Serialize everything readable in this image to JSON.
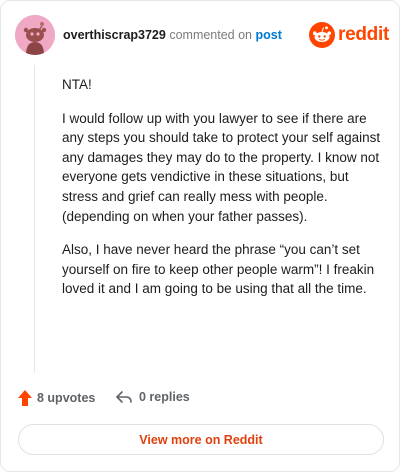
{
  "header": {
    "username": "overthiscrap3729",
    "commented_on": "commented on",
    "post_link": "post",
    "logo_text": "reddit"
  },
  "comment": {
    "paragraphs": [
      "NTA!",
      "I would follow up with you lawyer to see if there are any steps you should take to protect your self against any damages they may do to the property. I know not everyone gets vendictive in these situations, but stress and grief can really mess with people.(depending on when your father passes).",
      "Also, I have never heard the phrase “you can’t set yourself on fire to keep other people warm”! I freakin loved it and I am going to be using that all the time."
    ]
  },
  "footer": {
    "upvotes": "8 upvotes",
    "replies": "0 replies"
  },
  "view_more_label": "View more on Reddit",
  "colors": {
    "brand": "#ff4500",
    "link": "#0079d3",
    "upvote": "#ff4500"
  },
  "icons": {
    "avatar": "snoo-avatar",
    "logo": "reddit-logo",
    "upvote": "upvote-arrow-icon",
    "reply": "reply-arrow-icon"
  }
}
